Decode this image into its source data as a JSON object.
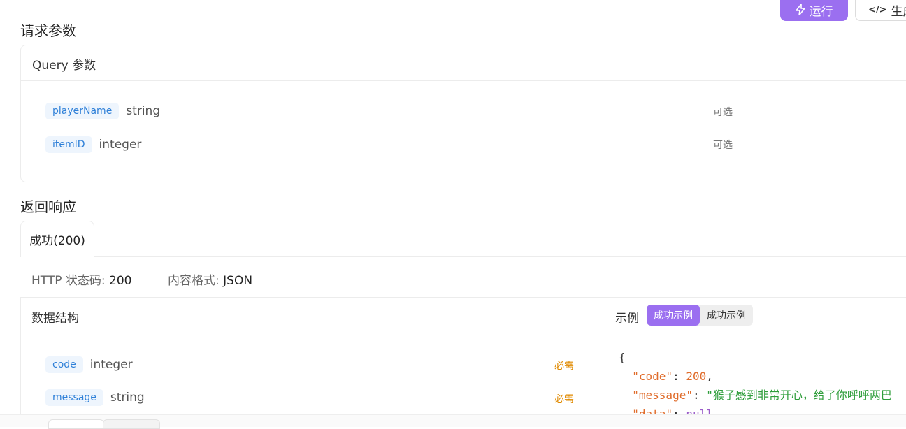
{
  "toolbar": {
    "run_label": "运行",
    "generate_label": "生成"
  },
  "request": {
    "section_title": "请求参数",
    "query_header": "Query 参数",
    "params": [
      {
        "name": "playerName",
        "type": "string",
        "status": "可选"
      },
      {
        "name": "itemID",
        "type": "integer",
        "status": "可选"
      }
    ]
  },
  "response": {
    "section_title": "返回响应",
    "tab_label": "成功(200)",
    "status_label": "HTTP 状态码:",
    "status_value": "200",
    "format_label": "内容格式:",
    "format_value": "JSON",
    "schema_header": "数据结构",
    "fields": [
      {
        "name": "code",
        "type": "integer",
        "status": "必需"
      },
      {
        "name": "message",
        "type": "string",
        "status": "必需"
      }
    ],
    "example_label": "示例",
    "example_tabs": [
      "成功示例",
      "成功示例"
    ],
    "example_lines": [
      "{",
      "\"code\"",
      "200",
      "\"message\"",
      "\"猴子感到非常开心，给了你呼呼两巴",
      "\"data\"",
      "null"
    ]
  },
  "colors": {
    "accent": "#9b6ff0",
    "tag_bg": "#eef5fd",
    "tag_text": "#2f80d8",
    "required": "#e08a00"
  }
}
